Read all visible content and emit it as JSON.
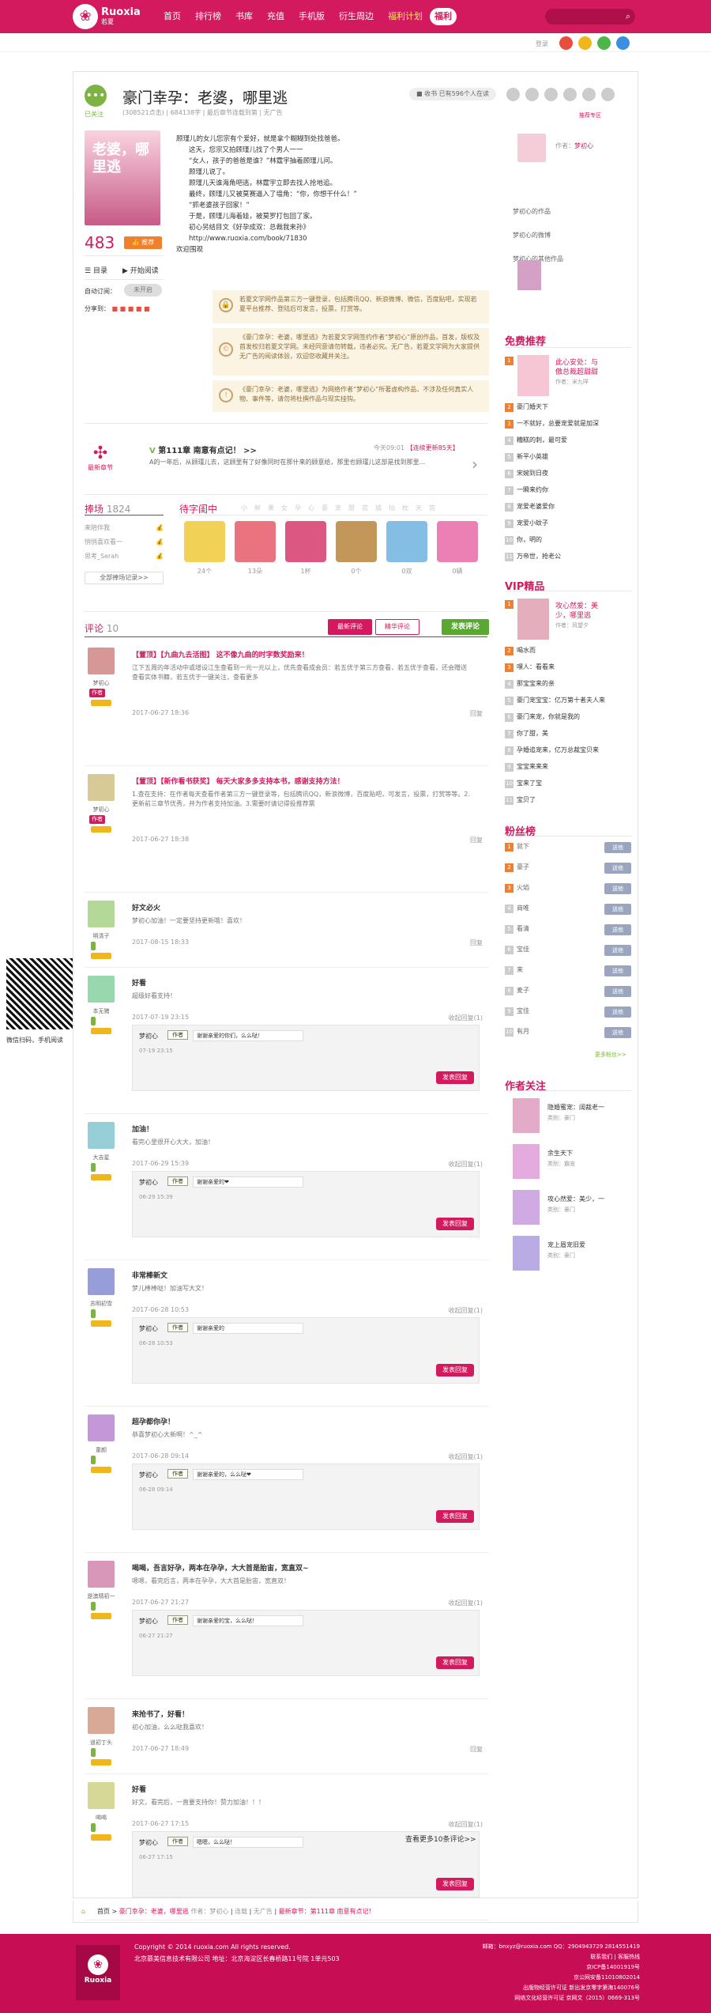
{
  "site": {
    "name": "Ruoxia",
    "sub": "若夏",
    "logo": "flower-logo-icon"
  },
  "nav": [
    "首页",
    "排行榜",
    "书库",
    "充值",
    "手机版",
    "衍生周边",
    "福利计划",
    "福利"
  ],
  "top_links": {
    "login": "登录"
  },
  "book": {
    "title": "豪门幸孕：老婆，哪里逃",
    "follow_label": "已关注",
    "meta_clicks": "(308521点击)",
    "meta_chars": "684138字",
    "meta_status": "最后章节连载到第",
    "meta_end": "无广告",
    "stat_btn": "■ 收书 已有596个人在读",
    "cover_title": "老婆，哪里逃",
    "likes": "483",
    "like_btn": "👍 推荐",
    "toc": "目录",
    "start_read": "开始阅读",
    "auto_sub_label": "自动订阅：",
    "auto_sub_val": "未开启",
    "share": "分享到：",
    "intro": [
      "顾瑾儿的女儿您宗有个爱好，就是拿个糊糊到处找爸爸。",
      "这天，您宗又拍顾瑾儿找了个男人一一",
      "“女人，孩子的爸爸是谁？”林霆宇抽着顾瑾儿问。",
      "顾瑾儿说了。",
      "顾瑾儿天谁海角吧逃，林霆宇立即去找人抢地追。",
      "最终，顾瑾儿又被莫赛逼入了墙角：“你，你想干什么！”",
      "“抓老婆孩子回家！”",
      "于是，顾瑾儿海着娃，被莫罗打包回了家。",
      "初心另结目文《好孕成双：总裁我来孙》http://www.ruoxia.com/book/71830",
      "欢迎围观"
    ],
    "notices": [
      "若夏文学网作品第三方一键登录，包括腾讯QQ、新浪微博、微信，百度贴吧，实现若夏平台推荐、登陆后可发言，投票，打赏等。",
      "《豪门幸孕：老婆，哪里逃》为若夏文学网签约作者“梦初心”原创作品，首发，版权及首发权归若夏文学网。未经同意请勿转载，违者必究。无广告，若夏文学网为大家提供无广告的阅读体验，欢迎您收藏并关注。",
      "《豪门幸孕：老婆，哪里逃》为网络作者“梦初心”所著虚构作品，不涉及任何真实人物、事件等，请勿将杜撰作品与现实挂钩。"
    ]
  },
  "latest": {
    "label": "最新章节",
    "chapter": "第111章  南意有点记！ >>",
    "time": "今天09:01",
    "recent": "【连续更新85天】",
    "text": "A的一年后，从顾瑾儿去，这顾里有了好像同时在那什来的顾意给，那里也顾瑾儿这部是找到那里..."
  },
  "tabs_left": {
    "label": "捧场",
    "count": "1824"
  },
  "supporters": [
    "来陪伴我",
    "悄悄喜欢看一",
    "思考_Serah"
  ],
  "supp_more": "全部捧场记录>>",
  "gift_tab": "待字闺中",
  "gift_cats": [
    "小",
    "鲜",
    "果",
    "女",
    "孕",
    "心",
    "豪",
    "宠",
    "甜",
    "宫",
    "城",
    "仙",
    "枕",
    "天",
    "宫"
  ],
  "gifts": [
    {
      "c": "#f0c93a",
      "n": "24个"
    },
    {
      "c": "#e65a6a",
      "n": "13朵"
    },
    {
      "c": "#d63a6c",
      "n": "1杯"
    },
    {
      "c": "#b8843c",
      "n": "0个"
    },
    {
      "c": "#6fb3e0",
      "n": "0双"
    },
    {
      "c": "#e86aa8",
      "n": "0辆"
    }
  ],
  "comments": {
    "title": "评论",
    "count": "10",
    "tab_new": "最新评论",
    "tab_hot": "精华评论",
    "post_btn": "发表评论",
    "reply_btn": "发表回复",
    "more": "查看更多10条评论>>",
    "items": [
      {
        "title": "【置顶】【九曲九去活图】 这不像九曲的时字数奖励来！",
        "body": "江下五周的年活动中或增设江生查看到一元一元以上，优先查看成会员：若五优于第三方查看，若五优于查看，还会赠送查看实体书籍，若五优于一键关注，查看更多",
        "user": "梦初心",
        "badge": "作者",
        "time": "2017-06-27 18:36",
        "action": "回复"
      },
      {
        "title": "【置顶】【新作看书获奖】 每天大家多多支持本书，感谢支持方法！",
        "body": "1.查在支持：在作者每天查看作者第三方一键登录等，包括腾讯QQ，新浪微博，百度贴吧，可发言，投票，打赏等等。2.更新前三章节优秀，并为作者支持加油。3.需要时请记得投推荐票",
        "user": "梦初心",
        "badge": "作者",
        "time": "2017-06-27 18:38",
        "action": "回复"
      },
      {
        "title": "好文必火",
        "body": "梦初心加油！一定要坚持更新哦！喜欢！",
        "user": "明清子",
        "time": "2017-08-15 18:33",
        "action": "回复"
      },
      {
        "title": "好看",
        "body": "超级好看支持！",
        "user": "本无猪",
        "time": "2017-07-19 23:15",
        "action": "收起回复(1)",
        "reply_user": "梦初心",
        "reply_text": "谢谢亲爱的你们，么么哒！",
        "reply_time": "07-19 23:15"
      },
      {
        "title": "加油！",
        "body": "看完心里很开心大大，加油！",
        "user": "大吉星",
        "time": "2017-06-29 15:39",
        "action": "收起回复(1)",
        "reply_user": "梦初心",
        "reply_text": "谢谢亲爱的❤",
        "reply_time": "06-29 15:39"
      },
      {
        "title": "非常棒新文",
        "body": "梦儿棒棒哒！加油写大文！",
        "user": "苏明初雪",
        "time": "2017-06-28 10:53",
        "action": "收起回复(1)",
        "reply_user": "梦初心",
        "reply_text": "谢谢亲爱的",
        "reply_time": "06-28 10:53"
      },
      {
        "title": "超孕都你孕！",
        "body": "恭喜梦初心大新啊！^_^",
        "user": "童颜",
        "time": "2017-06-28 09:14",
        "action": "收起回复(1)",
        "reply_user": "梦初心",
        "reply_text": "谢谢亲爱的，么么哒❤",
        "reply_time": "06-28 09:14"
      },
      {
        "title": "喝喝，吾言好孕，两本在孕孕，大大首是胎宙，宽直双~",
        "body": "嗯嗯，看完后言，两本在孕孕，大大首是胎宙，宽直双！",
        "user": "是澳晴初一",
        "time": "2017-06-27 21:27",
        "action": "收起回复(1)",
        "reply_user": "梦初心",
        "reply_text": "谢谢亲爱的宝，么么哒！",
        "reply_time": "06-27 21:27"
      },
      {
        "title": "来抢书了，好看！",
        "body": "初心加油，么么哒我喜欢！",
        "user": "道初丁头",
        "time": "2017-06-27 18:49",
        "action": "回复"
      },
      {
        "title": "好看",
        "body": "好文，看完后，一直要支持你！赞力加油！！！",
        "user": "喝喝",
        "time": "2017-06-27 17:15",
        "action": "收起回复(1)",
        "reply_user": "梦初心",
        "reply_text": "嗯嗯，么么哒！",
        "reply_time": "06-27 17:15"
      }
    ]
  },
  "breadcrumb": {
    "home": "首页",
    "book": "豪门幸孕：老婆，哪里逃",
    "author": "作者：梦初心",
    "status": "连载",
    "ad": "无广告",
    "latest": "最新章节：第111章 南意有点记！"
  },
  "right": {
    "author_label": "梦初心",
    "author_title": "作者：",
    "links": [
      "梦初心的作品",
      "梦初心的微博",
      "梦初心的其他作品"
    ],
    "read_more": "推荐专区",
    "free_title": "免费推荐",
    "free_top": {
      "name": "此心安处：与",
      "name2": "傲总裁超甜甜",
      "author": "作者：米九咩"
    },
    "free_list": [
      "豪门婚天下",
      "一不就好，总要宠爱就是加深",
      "糟糕的刺，最可爱",
      "新平小英雄",
      "宋婉到日夜",
      "一瞬来约你",
      "宠爱老婆爱你",
      "宠爱小蚊子",
      "你，明的",
      "万帝世，抢老公"
    ],
    "vip_title": "VIP精品",
    "vip_top": {
      "name": "攻心然爱：美",
      "name2": "少，哪里逃",
      "author": "作者：风望夕"
    },
    "vip_list": [
      "喝水而",
      "嘿人：看看来",
      "那宝宝来的亲",
      "豪门宠宝宝：亿万第十者夫人来",
      "豪门来宠，你就是我的",
      "你了甜，美",
      "孕婚追宠来，亿万总裁宝贝来",
      "宝宝来来来",
      "宝来了宝",
      "宝贝了"
    ],
    "fans_title": "粉丝榜",
    "fans": [
      "就下",
      "豪子 ",
      "火焰",
      "商唯",
      "看清 ",
      "宝佳",
      "来",
      "麦子 ",
      "宝佳 ",
      "有月"
    ],
    "fans_btn": "送他",
    "fans_more": "更多粉丝>>",
    "follow_title": "作者关注",
    "follows": [
      {
        "n": "隐婚蜜宠：阔裁老一",
        "c": "类别：豪门"
      },
      {
        "n": "余生天下",
        "c": "类别：霸宠"
      },
      {
        "n": "攻心然爱：美少，一",
        "c": "类别：豪门"
      },
      {
        "n": "宠上眉宠旧爱",
        "c": "类别：豪门"
      }
    ]
  },
  "qr": "微信扫码，手机阅读",
  "footer": {
    "copy": "Copyright © 2014 ruoxia.com All rights reserved.",
    "co": "北京慕美信息技术有限公司  地址：北京海淀区长春桥路11号院 1单元503",
    "right1": "邮箱：bnxyz@ruoxia.com  QQ：2904943729 2814551419",
    "right2": "联系我们  |  客服热线",
    "right3": "京ICP备14001919号",
    "right4": "京公网安备11010802014",
    "right5": "出版物经营许可证 新出发京零字第海140076号",
    "right6": "网络文化经营许可证  京网文（2015）0669-313号"
  }
}
